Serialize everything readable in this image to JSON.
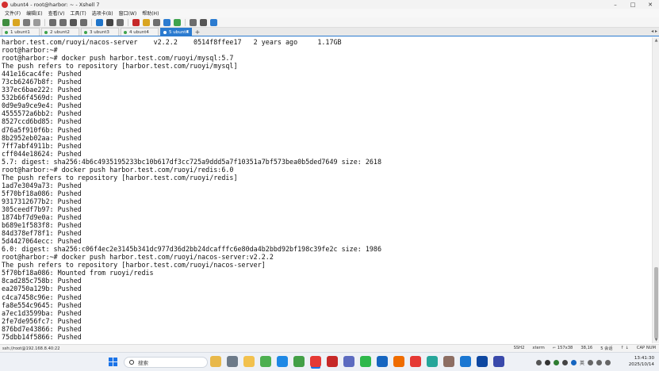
{
  "window": {
    "title": "ubunt4 - root@harbor: ~ - Xshell 7",
    "controls": [
      "–",
      "□",
      "✕"
    ]
  },
  "menu": [
    "文件(F)",
    "编辑(E)",
    "查看(V)",
    "工具(T)",
    "选项卡(B)",
    "窗口(W)",
    "帮助(H)"
  ],
  "toolbar_icons": [
    {
      "name": "new-session-icon",
      "color": "#3f8d3f"
    },
    {
      "name": "open-folder-icon",
      "color": "#d9a520"
    },
    {
      "name": "link-icon",
      "color": "#7a7a7a"
    },
    {
      "name": "disconnect-icon",
      "color": "#9a9a9a"
    },
    {
      "name": "copy-icon",
      "color": "#6d6d6d"
    },
    {
      "name": "paste-icon",
      "color": "#6d6d6d"
    },
    {
      "name": "find-icon",
      "color": "#555555"
    },
    {
      "name": "print-icon",
      "color": "#6d6d6d"
    },
    {
      "name": "globe-icon",
      "color": "#1f74c9"
    },
    {
      "name": "font-icon",
      "color": "#444444"
    },
    {
      "name": "script-icon",
      "color": "#6d6d6d"
    },
    {
      "name": "xftp-icon",
      "color": "#c62828"
    },
    {
      "name": "lock-icon",
      "color": "#d9a520"
    },
    {
      "name": "keyboard-icon",
      "color": "#6d6d6d"
    },
    {
      "name": "compose-icon",
      "color": "#2b7bd0"
    },
    {
      "name": "tunnel-icon",
      "color": "#3fa34d"
    },
    {
      "name": "fullscreen-icon",
      "color": "#6d6d6d"
    },
    {
      "name": "layout-icon",
      "color": "#555555"
    },
    {
      "name": "help-icon",
      "color": "#2b7bd0"
    }
  ],
  "tabs": [
    {
      "label": "1 ubunt1",
      "active": false
    },
    {
      "label": "2 ubunt2",
      "active": false
    },
    {
      "label": "3 ubunt3",
      "active": false
    },
    {
      "label": "4 ubunt4",
      "active": false
    },
    {
      "label": "5 ubunt4",
      "active": true
    }
  ],
  "terminal_lines": [
    "harbor.test.com/ruoyi/nacos-server    v2.2.2    0514f8ffee17   2 years ago     1.17GB",
    "root@harbor:~#",
    "root@harbor:~# docker push harbor.test.com/ruoyi/mysql:5.7",
    "The push refers to repository [harbor.test.com/ruoyi/mysql]",
    "441e16cac4fe: Pushed",
    "73cb62467b8f: Pushed",
    "337ec6bae222: Pushed",
    "532b66f4569d: Pushed",
    "0d9e9a9ce9e4: Pushed",
    "4555572a6bb2: Pushed",
    "8527ccd6bd85: Pushed",
    "d76a5f910f6b: Pushed",
    "8b2952eb02aa: Pushed",
    "7ff7abf4911b: Pushed",
    "cff044e18624: Pushed",
    "5.7: digest: sha256:4b6c4935195233bc10b617df3cc725a9ddd5a7f10351a7bf573bea0b5ded7649 size: 2618",
    "root@harbor:~# docker push harbor.test.com/ruoyi/redis:6.0",
    "The push refers to repository [harbor.test.com/ruoyi/redis]",
    "1ad7e3049a73: Pushed",
    "5f70bf18a086: Pushed",
    "9317312677b2: Pushed",
    "305ceedf7b97: Pushed",
    "1874bf7d9e0a: Pushed",
    "b689e1f583f8: Pushed",
    "84d378ef78f1: Pushed",
    "5d4427064ecc: Pushed",
    "6.0: digest: sha256:c06f4ec2e3145b341dc977d36d2bb24dcafffc6e80da4b2bbd92bf198c39fe2c size: 1986",
    "root@harbor:~# docker push harbor.test.com/ruoyi/nacos-server:v2.2.2",
    "The push refers to repository [harbor.test.com/ruoyi/nacos-server]",
    "5f70bf18a086: Mounted from ruoyi/redis",
    "8cad285c758b: Pushed",
    "ea20750a129b: Pushed",
    "c4ca7458c96e: Pushed",
    "fa8e554c9645: Pushed",
    "a7ec1d3599ba: Pushed",
    "2fe7de956fc7: Pushed",
    "876bd7e43866: Pushed",
    "75dbb14f5866: Pushed"
  ],
  "status": {
    "left": "ssh://root@192.168.8.40:22",
    "right": [
      "SSH2",
      "xterm",
      "⌐ 157x38",
      "38,16",
      "5 会话",
      "↑ ↓",
      "CAP NUM"
    ]
  },
  "taskbar": {
    "search_placeholder": "搜索",
    "apps": [
      {
        "name": "file-explorer-icon",
        "color": "#e8b84a"
      },
      {
        "name": "settings-icon",
        "color": "#6c7a89"
      },
      {
        "name": "folder-icon",
        "color": "#f2c14e"
      },
      {
        "name": "chrome-icon",
        "color": "#4caf50"
      },
      {
        "name": "vscode-icon",
        "color": "#1e88e5"
      },
      {
        "name": "app-icon",
        "color": "#43a047"
      },
      {
        "name": "xshell-icon",
        "color": "#e53935",
        "active": true
      },
      {
        "name": "app-icon",
        "color": "#c62828"
      },
      {
        "name": "app-icon",
        "color": "#5c6bc0"
      },
      {
        "name": "wechat-icon",
        "color": "#2eb84b"
      },
      {
        "name": "app-icon",
        "color": "#1565c0"
      },
      {
        "name": "app-icon",
        "color": "#ef6c00"
      },
      {
        "name": "chrome-icon",
        "color": "#e53935"
      },
      {
        "name": "app-icon",
        "color": "#26a69a"
      },
      {
        "name": "app-icon",
        "color": "#8d6e63"
      },
      {
        "name": "app-icon",
        "color": "#1976d2"
      },
      {
        "name": "app-icon",
        "color": "#0d47a1"
      },
      {
        "name": "visio-icon",
        "color": "#3949ab"
      }
    ],
    "tray_lang": "英",
    "time": "13:41:30",
    "date": "2025/10/14"
  }
}
